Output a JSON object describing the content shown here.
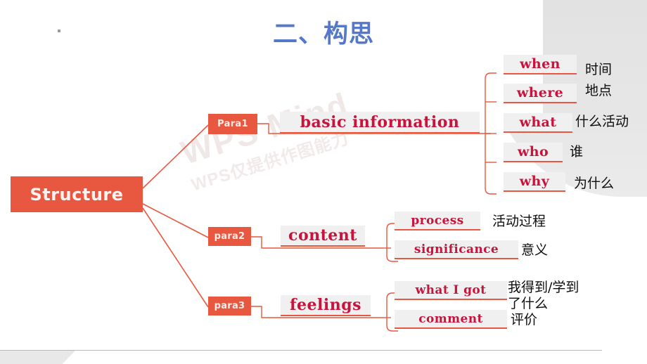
{
  "slide": {
    "title": "二、构思",
    "title_color": "#5578c8",
    "accent_color": "#e8573f",
    "text_red": "#c8143c",
    "watermark_main": "WPS Mind",
    "watermark_sub": "WPS仅提供作图能力"
  },
  "mindmap": {
    "root": {
      "label": "Structure"
    },
    "branches": [
      {
        "node": "Para1",
        "topic": "basic information",
        "children": [
          {
            "label": "when",
            "note": "时间"
          },
          {
            "label": "where",
            "note": "地点"
          },
          {
            "label": "what",
            "note": "什么活动"
          },
          {
            "label": "who",
            "note": "谁"
          },
          {
            "label": "why",
            "note": "为什么"
          }
        ]
      },
      {
        "node": "para2",
        "topic": "content",
        "children": [
          {
            "label": "process",
            "note": "活动过程"
          },
          {
            "label": "significance",
            "note": "意义"
          }
        ]
      },
      {
        "node": "para3",
        "topic": "feelings",
        "children": [
          {
            "label": "what I got",
            "note": "我得到/学到了什么"
          },
          {
            "label": "comment",
            "note": "评价"
          }
        ]
      }
    ]
  }
}
